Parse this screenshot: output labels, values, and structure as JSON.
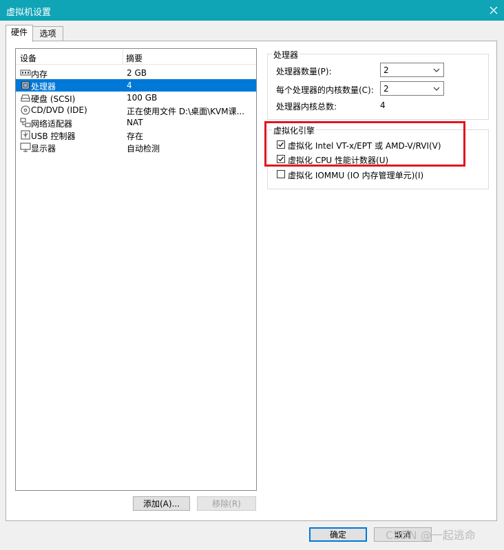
{
  "window": {
    "title": "虚拟机设置"
  },
  "tabs": [
    {
      "label": "硬件"
    },
    {
      "label": "选项"
    }
  ],
  "device_list": {
    "headers": {
      "device": "设备",
      "summary": "摘要"
    },
    "rows": [
      {
        "icon": "memory-icon",
        "name": "内存",
        "summary": "2 GB"
      },
      {
        "icon": "cpu-icon",
        "name": "处理器",
        "summary": "4"
      },
      {
        "icon": "hard-disk-icon",
        "name": "硬盘 (SCSI)",
        "summary": "100 GB"
      },
      {
        "icon": "cd-dvd-icon",
        "name": "CD/DVD (IDE)",
        "summary": "正在使用文件 D:\\桌面\\KVM课..."
      },
      {
        "icon": "network-icon",
        "name": "网络适配器",
        "summary": "NAT"
      },
      {
        "icon": "usb-icon",
        "name": "USB 控制器",
        "summary": "存在"
      },
      {
        "icon": "display-icon",
        "name": "显示器",
        "summary": "自动检测"
      }
    ],
    "selected_index": 1
  },
  "buttons": {
    "add": "添加(A)...",
    "remove": "移除(R)",
    "ok": "确定",
    "cancel": "取消"
  },
  "processor": {
    "legend": "处理器",
    "count_label": "处理器数量(P):",
    "count_value": "2",
    "cores_label": "每个处理器的内核数量(C):",
    "cores_value": "2",
    "total_label": "处理器内核总数:",
    "total_value": "4"
  },
  "virtualization": {
    "legend": "虚拟化引擎",
    "options": [
      {
        "label": "虚拟化 Intel VT-x/EPT 或 AMD-V/RVI(V)",
        "checked": true
      },
      {
        "label": "虚拟化 CPU 性能计数器(U)",
        "checked": true
      },
      {
        "label": "虚拟化 IOMMU (IO 内存管理单元)(I)",
        "checked": false
      }
    ]
  },
  "watermark": "CSDN @一起逃命",
  "colors": {
    "titlebar": "#0fa4b6",
    "selection": "#0078d7",
    "highlight_box": "#e0141e"
  }
}
